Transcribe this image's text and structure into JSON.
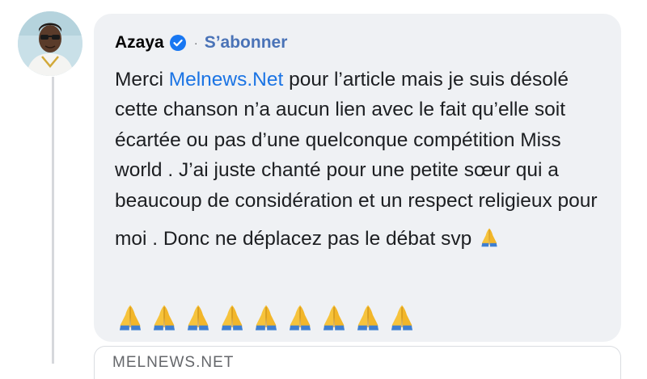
{
  "comment": {
    "author": "Azaya",
    "separator": "·",
    "follow_label": "S’abonner",
    "text": {
      "lead": "Merci ",
      "mention": "Melnews.Net",
      "rest": " pour l’article mais je suis désolé cette chanson n’a aucun lien avec le fait qu’elle soit écartée ou pas d’une quelconque compétition Miss world . J’ai juste chanté pour une petite sœur qui a beaucoup de considération et un respect religieux pour",
      "last_line": "moi . Donc ne déplacez pas le débat svp"
    },
    "emoji_row": [
      "pray-emoji",
      "pray-emoji",
      "pray-emoji",
      "pray-emoji",
      "pray-emoji",
      "pray-emoji",
      "pray-emoji",
      "pray-emoji",
      "pray-emoji"
    ],
    "icons": {
      "avatar": "user-avatar",
      "verified": "verified-badge-icon",
      "emoji": "folded-hands-emoji"
    }
  },
  "link_preview": {
    "domain": "MELNEWS.NET"
  },
  "colors": {
    "bubble": "#eff1f4",
    "mention": "#1b74e4",
    "follow": "#4a73b7",
    "verified": "#1877f2"
  }
}
